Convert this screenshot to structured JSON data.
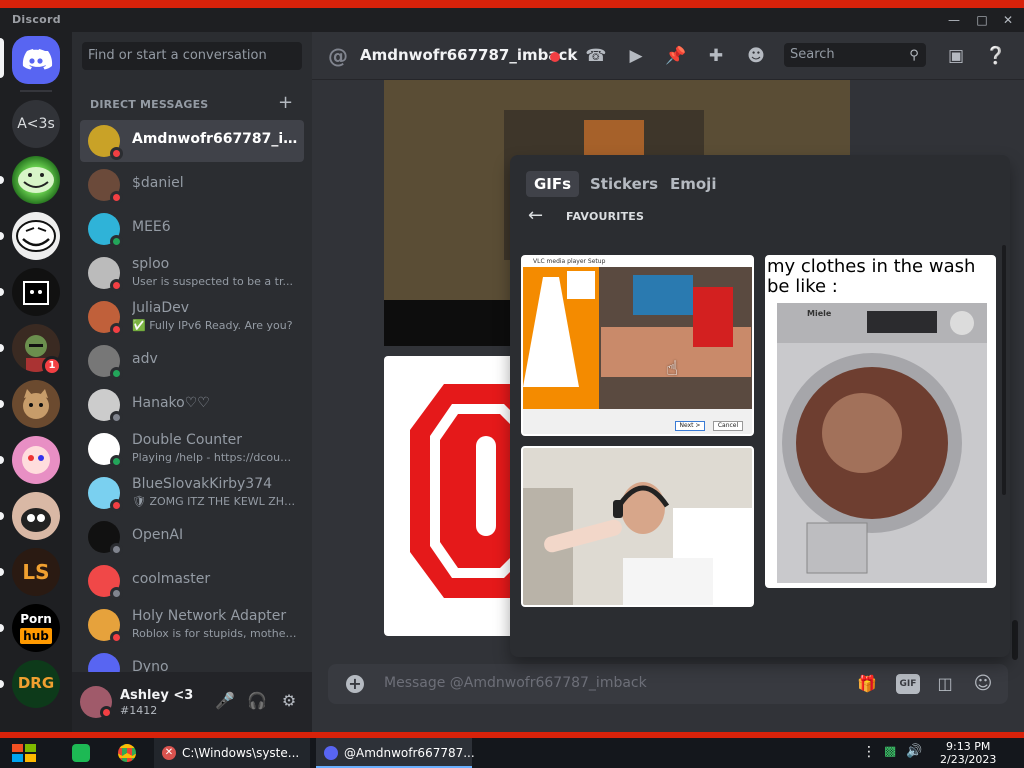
{
  "titlebar": {
    "app_name": "Discord"
  },
  "servers": [
    {
      "name": "Direct Messages",
      "icon": "discord-logo-icon",
      "color": "#5865f2"
    },
    {
      "name": "A<3s",
      "label": "A<3s"
    },
    {
      "name": "trollface-server"
    },
    {
      "name": "troll-server-2"
    },
    {
      "name": "dark-server"
    },
    {
      "name": "character-server",
      "badge": "1"
    },
    {
      "name": "cat-server"
    },
    {
      "name": "pink-server"
    },
    {
      "name": "face-server"
    },
    {
      "name": "LS-server",
      "label": "LS"
    },
    {
      "name": "ph-server",
      "label_top": "Porn",
      "label_bottom": "hub"
    },
    {
      "name": "DRG-server",
      "label": "DRG"
    }
  ],
  "sidebar": {
    "search_placeholder": "Find or start a conversation",
    "section_title": "DIRECT MESSAGES",
    "dms": [
      {
        "name": "Amdnwofr667787_im...",
        "status": "dnd",
        "active": true
      },
      {
        "name": "$daniel",
        "status": "dnd"
      },
      {
        "name": "MEE6",
        "status": "online"
      },
      {
        "name": "sploo",
        "sub": "User is suspected to be a tr...",
        "status": "dnd"
      },
      {
        "name": "JuliaDev",
        "sub": "✅ Fully IPv6 Ready. Are you?",
        "status": "dnd"
      },
      {
        "name": "adv",
        "status": "online"
      },
      {
        "name": "Hanako♡♡",
        "status": "offline"
      },
      {
        "name": "Double Counter",
        "sub": "Playing /help - https://dcount...",
        "status": "online"
      },
      {
        "name": "BlueSlovakKirby374",
        "sub": "🛡 ZOMG ITZ THE KEWL ZHIE...",
        "status": "dnd"
      },
      {
        "name": "OpenAI",
        "status": "offline"
      },
      {
        "name": "coolmaster",
        "status": "offline"
      },
      {
        "name": "Holy Network Adapter",
        "sub": "Roblox is for stupids, motherf...",
        "status": "dnd"
      },
      {
        "name": "Dyno",
        "status": "online"
      }
    ]
  },
  "user_panel": {
    "name": "Ashley <3",
    "tag": "#1412"
  },
  "header": {
    "at": "@",
    "channel_name": "Amdnwofr667787_imback",
    "search_placeholder": "Search"
  },
  "composer": {
    "placeholder": "Message @Amdnwofr667787_imback",
    "gif_label": "GIF"
  },
  "picker": {
    "tabs": [
      "GIFs",
      "Stickers",
      "Emoji"
    ],
    "section": "FAVOURITES",
    "gifs": [
      {
        "name": "vlc-setup-gif",
        "caption": "VLC media player Setup",
        "button_next": "Next >",
        "button_cancel": "Cancel"
      },
      {
        "name": "washing-machine-gif",
        "caption": "my clothes in the wash be like :",
        "brand": "Miele"
      },
      {
        "name": "headset-guy-gif"
      }
    ]
  },
  "taskbar": {
    "items": [
      {
        "label": "C:\\Windows\\syste...",
        "icon": "cmd-icon"
      },
      {
        "label": "@Amdnwofr667787...",
        "icon": "discord-icon"
      }
    ],
    "time": "9:13 PM",
    "date": "2/23/2023"
  },
  "colors": {
    "accent": "#5865f2",
    "dnd": "#f23f43",
    "online": "#23a55a",
    "offline": "#80848e",
    "brand_red": "#d8220a"
  }
}
